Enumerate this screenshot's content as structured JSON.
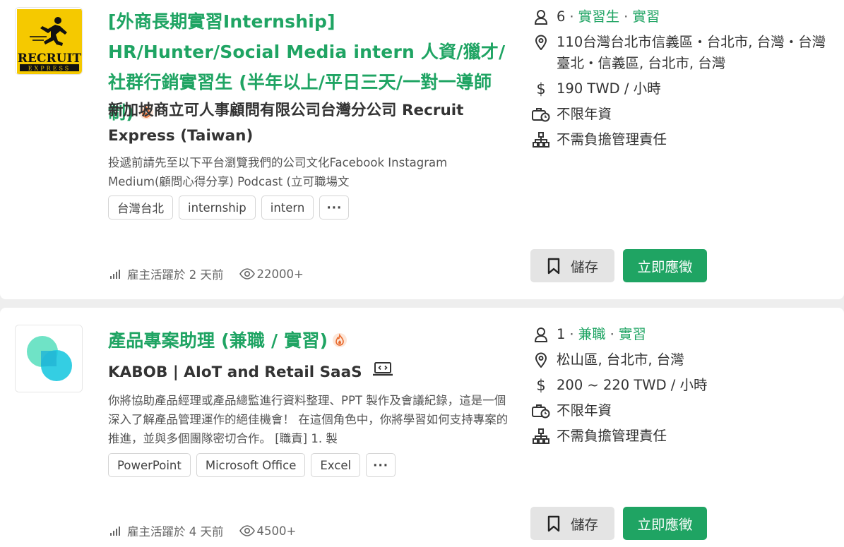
{
  "jobs": [
    {
      "logo_text": "RECRUIT",
      "logo_sub": "EXPRESS",
      "title": "[外商長期實習Internship] HR/Hunter/Social Media intern 人資/獵才/社群行銷實習生 (半年以上/平日三天/一對一導師制)",
      "company": "新加坡商立可人事顧問有限公司台灣分公司 Recruit Express (Taiwan)",
      "description": "投遞前請先至以下平台瀏覽我們的公司文化Facebook Instagram Medium(顧問心得分享) Podcast (立可職場文",
      "tags": [
        "台灣台北",
        "internship",
        "intern"
      ],
      "more": "···",
      "activity": "雇主活躍於 2 天前",
      "views": "22000+",
      "openings": "6",
      "job_type": "實習生",
      "job_type2": "實習",
      "location": "110台灣台北市信義區・台北市, 台灣・台灣臺北・信義區, 台北市, 台灣",
      "salary": "190 TWD / 小時",
      "experience": "不限年資",
      "management": "不需負擔管理責任",
      "save_label": "儲存",
      "apply_label": "立即應徵"
    },
    {
      "title": "產品專案助理 (兼職 / 實習)",
      "company": "KABOB | AIoT and Retail SaaS",
      "description": "你將協助產品經理或產品總監進行資料整理、PPT 製作及會議紀錄，這是一個深入了解產品管理運作的絕佳機會！ 在這個角色中，你將學習如何支持專案的推進，並與多個團隊密切合作。 [職責] 1. 製",
      "tags": [
        "PowerPoint",
        "Microsoft Office",
        "Excel"
      ],
      "more": "···",
      "activity": "雇主活躍於 4 天前",
      "views": "4500+",
      "openings": "1",
      "job_type": "兼職",
      "job_type2": "實習",
      "location": "松山區, 台北市, 台灣",
      "salary": "200 ~ 220 TWD / 小時",
      "experience": "不限年資",
      "management": "不需負擔管理責任",
      "save_label": "儲存",
      "apply_label": "立即應徵"
    }
  ],
  "colors": {
    "accent": "#1fa463",
    "save_bg": "#e4e4e4"
  },
  "icons": [
    "person-icon",
    "location-pin-icon",
    "dollar-icon",
    "briefcase-clock-icon",
    "org-chart-icon",
    "signal-bars-icon",
    "eye-icon",
    "bookmark-icon",
    "fire-icon",
    "laptop-code-icon"
  ]
}
